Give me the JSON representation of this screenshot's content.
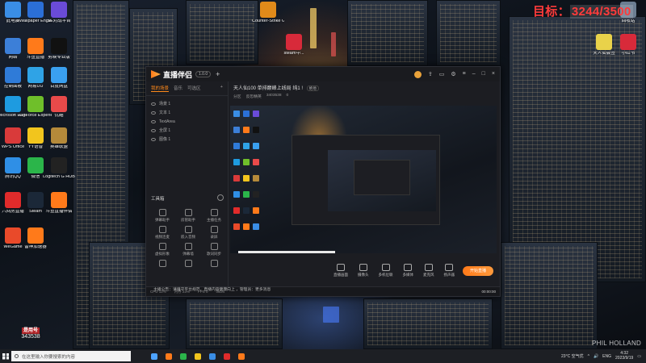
{
  "desktop": {
    "target": {
      "label": "目标：",
      "value": "3244/3500"
    },
    "watermark": "PHIL HOLLAND",
    "user_badge": {
      "name": "是用号",
      "id": "343538"
    },
    "icons_left": [
      {
        "label": "此电脑",
        "color": "#3a8ee6"
      },
      {
        "label": "Wallpaper Engine",
        "color": "#2b6fd6"
      },
      {
        "label": "SE对战平台",
        "color": "#6a4bd8"
      },
      {
        "label": "网络",
        "color": "#3c7fd8"
      },
      {
        "label": "斗鱼直播",
        "color": "#ff7a1a"
      },
      {
        "label": "剪映专业版",
        "color": "#111111"
      },
      {
        "label": "控制面板",
        "color": "#2f7bd8"
      },
      {
        "label": "网易UU",
        "color": "#2fa3e6"
      },
      {
        "label": "百度网盘",
        "color": "#3aa0f0"
      },
      {
        "label": "Microsoft Edge",
        "color": "#1e9be0"
      },
      {
        "label": "GeForce Experience",
        "color": "#6fbf2a"
      },
      {
        "label": "优酷",
        "color": "#e94a4a"
      },
      {
        "label": "WPS Office",
        "color": "#d93a3a"
      },
      {
        "label": "YY语音",
        "color": "#f2c51d"
      },
      {
        "label": "英雄联盟",
        "color": "#b58a3a"
      },
      {
        "label": "腾讯QQ",
        "color": "#2f8fe6"
      },
      {
        "label": "微信",
        "color": "#2bb54a"
      },
      {
        "label": "Logitech G HUB",
        "color": "#222222"
      },
      {
        "label": "六间房直播",
        "color": "#e02b2b"
      },
      {
        "label": "Steam",
        "color": "#1b2838"
      },
      {
        "label": "斗鱼直播伴侣",
        "color": "#ff7a1a"
      },
      {
        "label": "WeGame",
        "color": "#e94a2a"
      },
      {
        "label": "雷神加速器",
        "color": "#ff7a1a"
      }
    ],
    "icons_top": [
      {
        "label": "Counter-Strike Global Off",
        "color": "#e08a1a"
      },
      {
        "label": "steam中...",
        "color": "#d82a3a"
      },
      {
        "label": "回收站",
        "color": "#6b7d91"
      },
      {
        "label": "TeamViewer",
        "color": "#1a5fb4"
      },
      {
        "label": "天人仙会签",
        "color": "#e9d24a"
      },
      {
        "label": "小红书",
        "color": "#d82a3a"
      }
    ]
  },
  "app": {
    "title": "直播伴侣",
    "version": "1.0.0",
    "left_tabs": [
      "我的场景",
      "音乐",
      "可选区"
    ],
    "scenes": [
      "场景 1",
      "文本 1",
      "TextArea",
      "全屏 1",
      "图像 1"
    ],
    "tools_title": "工具箱",
    "tools": [
      "弹幕助手",
      "房管助手",
      "主播任务",
      "视频连麦",
      "嵌入音频",
      "录屏",
      "虚拟形象",
      "弹幕墙",
      "歌词同步",
      "",
      "",
      ""
    ],
    "stream": {
      "title": "天人仙100 单排巅峰上线局 纯1 !",
      "tag": "绝地",
      "category": "反恐精英",
      "room_label": "分区",
      "room_id": "3403538",
      "viewers": "0"
    },
    "bottom_buttons": [
      "直播画面",
      "摄像头",
      "多机位联",
      "多媒体",
      "麦克风",
      "扬声器"
    ],
    "start_live": "开始直播",
    "status": {
      "cpu": "CPU 12%",
      "mem": "内存 23%",
      "fps": "FPS 0",
      "bitrate": "0kb/s",
      "time": "00:00:00"
    },
    "notice": "主播公告：请遵守平台规范，直播内容健康向上 ，管理员：更多消息"
  },
  "taskbar": {
    "search_placeholder": "在这里输入你要搜索的内容",
    "weather": "23°C 空气优",
    "lang": "ENG",
    "time": "4:32",
    "date": "2023/9/19",
    "icons": [
      "#4da3ff",
      "#ff7a1a",
      "#2bb54a",
      "#f2c51d",
      "#3a8ee6",
      "#e02b2b",
      "#ff7a1a"
    ]
  }
}
